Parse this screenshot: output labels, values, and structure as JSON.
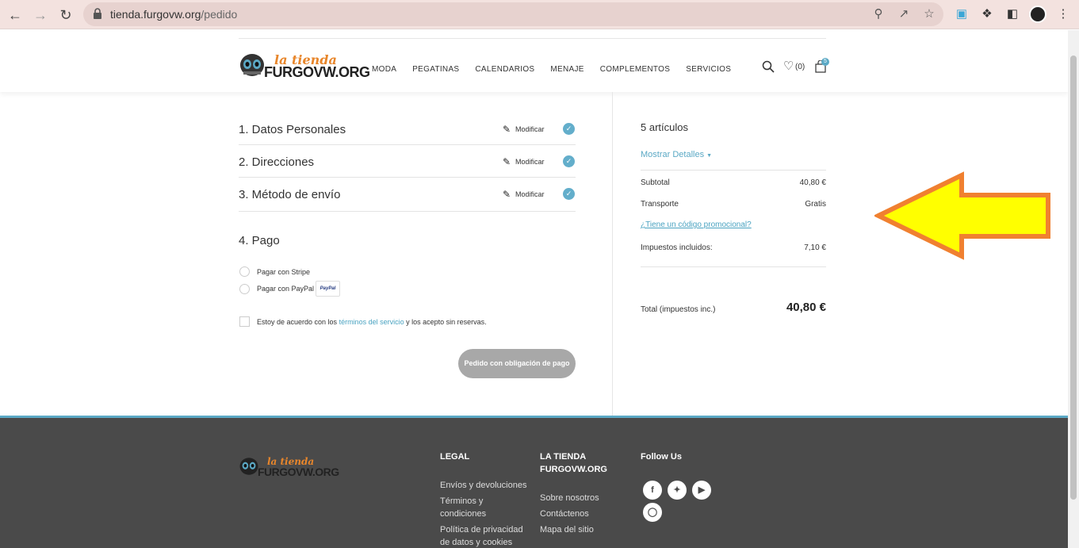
{
  "browser": {
    "url_host": "tienda.furgovw.org",
    "url_path": "/pedido"
  },
  "header": {
    "logo_top": "la tienda",
    "logo_main": "FURGOVW.ORG",
    "nav": [
      "MODA",
      "PEGATINAS",
      "CALENDARIOS",
      "MENAJE",
      "COMPLEMENTOS",
      "SERVICIOS"
    ],
    "wishlist_count": "(0)",
    "cart_count": "5"
  },
  "checkout": {
    "steps": [
      {
        "title": "1. Datos Personales",
        "action": "Modificar"
      },
      {
        "title": "2. Direcciones",
        "action": "Modificar"
      },
      {
        "title": "3. Método de envío",
        "action": "Modificar"
      }
    ],
    "payment_title": "4. Pago",
    "payment_options": [
      "Pagar con Stripe",
      "Pagar con PayPal"
    ],
    "paypal_badge": "PayPal",
    "terms_before": "Estoy de acuerdo con los ",
    "terms_link": "términos del servicio",
    "terms_after": " y los acepto sin reservas.",
    "order_button": "Pedido con obligación de pago"
  },
  "summary": {
    "items_count": "5 artículos",
    "show_details": "Mostrar Detalles",
    "subtotal_label": "Subtotal",
    "subtotal_value": "40,80 €",
    "shipping_label": "Transporte",
    "shipping_value": "Gratis",
    "promo_link": "¿Tiene un código promocional?",
    "taxes_label": "Impuestos incluidos:",
    "taxes_value": "7,10 €",
    "total_label": "Total (impuestos inc.)",
    "total_value": "40,80 €"
  },
  "footer": {
    "logo_top": "la tienda",
    "logo_main": "FURGOVW.ORG",
    "legal_title": "LEGAL",
    "legal_links": [
      "Envíos y devoluciones",
      "Términos y",
      "condiciones",
      "Política de privacidad",
      "de datos y cookies"
    ],
    "tienda_title_1": "LA TIENDA",
    "tienda_title_2": "FURGOVW.ORG",
    "tienda_links": [
      "Sobre nosotros",
      "Contáctenos",
      "Mapa del sitio"
    ],
    "follow_title": "Follow Us",
    "social_icons": [
      "facebook-icon",
      "twitter-icon",
      "youtube-icon",
      "instagram-icon"
    ]
  },
  "colors": {
    "accent": "#5ba9c5",
    "arrow_fill": "#ffff00",
    "arrow_stroke": "#f08030",
    "footer_bg": "#4a4a4a"
  }
}
